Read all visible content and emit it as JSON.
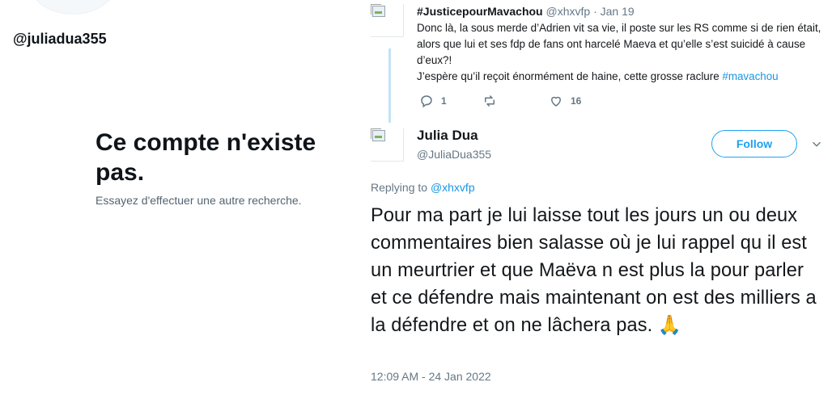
{
  "left_panel": {
    "handle": "@juliadua355",
    "title": "Ce compte n'existe pas.",
    "subtitle": "Essayez d'effectuer une autre recherche."
  },
  "tweet_parent": {
    "name": "#JusticepourMavachou",
    "handle": "@xhxvfp",
    "separator": "·",
    "date": "Jan 19",
    "body_line1": "Donc là, la sous merde d’Adrien vit sa vie, il poste sur les RS comme si de rien était, alors que lui et ses fdp de fans ont harcelé Maeva et qu’elle s’est suicidé à cause d’eux?!",
    "body_line2_text": "J’espère qu’il reçoit énormément de haine, cette grosse raclure ",
    "body_line2_hashtag": "#mavachou",
    "reply_count": "1",
    "retweet_count": "",
    "like_count": "16"
  },
  "tweet_main": {
    "name": "Julia Dua",
    "handle": "@JuliaDua355",
    "follow_label": "Follow",
    "replying_label": "Replying to ",
    "replying_handle": "@xhxvfp",
    "body": "Pour ma part je lui laisse tout les jours un ou deux commentaires bien salasse où je lui rappel qu il est un meurtrier et que Maëva n est plus la pour parler et ce défendre mais maintenant on est des milliers a la défendre et on ne lâchera pas. 🙏",
    "timestamp": "12:09 AM - 24 Jan 2022"
  },
  "colors": {
    "accent": "#1da1f2",
    "link": "#1b95e0",
    "muted": "#657786",
    "thread_line": "#c4e3f5"
  },
  "icons": [
    "reply-icon",
    "retweet-icon",
    "like-icon",
    "chevron-down-icon",
    "pray-emoji"
  ]
}
